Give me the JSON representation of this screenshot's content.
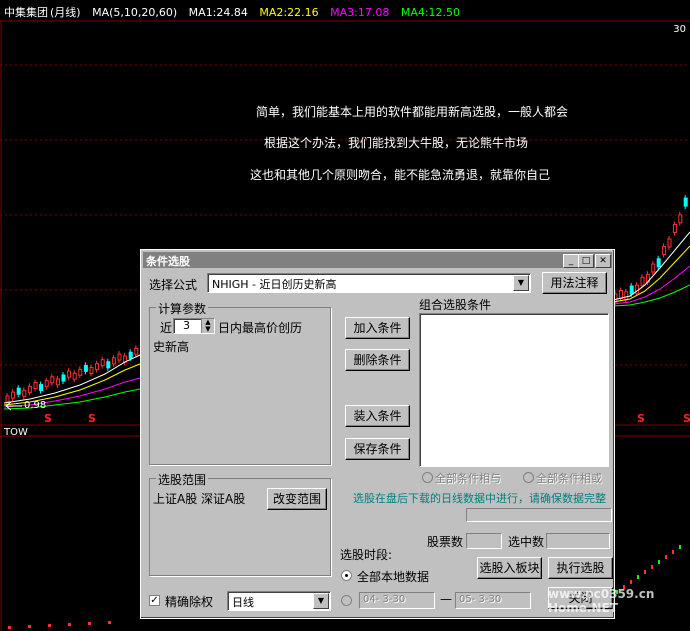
{
  "chart": {
    "stock_name": "中集集团",
    "period": "(月线)",
    "ma_params": "MA(5,10,20,60)",
    "ma1": "MA1:24.84",
    "ma2": "MA2:22.16",
    "ma3": "MA3:17.08",
    "ma4": "MA4:12.50",
    "ma_colors": {
      "ma1": "#ffffff",
      "ma2": "#ffff00",
      "ma3": "#ff00ff",
      "ma4": "#00ff00"
    },
    "indicator_label": "TOW",
    "low_price_label": "0.98",
    "right_top_value": "30",
    "signal_marker": "S",
    "messages": [
      "简单，我们能基本上用的软件都能用新高选股，一般人都会",
      "根据这个办法，我们能找到大牛股，无论熊牛市场",
      "这也和其他几个原则吻合，能不能急流勇退，就靠你自己"
    ],
    "watermark": "www.pc0359.cn Home.NET"
  },
  "dialog": {
    "title": "条件选股",
    "formula_label": "选择公式",
    "formula_value": "NHIGH    - 近日创历史新高",
    "usage_button": "用法注释",
    "calc_group": "计算参数",
    "param_prefix": "近",
    "param_value": "3",
    "param_suffix_1": "日内最高价创历",
    "param_suffix_2": "史新高",
    "combo_group": "组合选股条件",
    "add_button": "加入条件",
    "delete_button": "删除条件",
    "load_button": "装入条件",
    "save_button": "保存条件",
    "radio_and": "全部条件相与",
    "radio_or": "全部条件相或",
    "note": "选股在盘后下载的日线数据中进行，请确保数据完整",
    "range_group": "选股范围",
    "range_value": "上证A股 深证A股",
    "change_range_button": "改变范围",
    "stock_count_label": "股票数",
    "selected_label": "选中数",
    "period_label": "选股时段:",
    "all_local_label": "全部本地数据",
    "to_board_button": "选股入板块",
    "execute_button": "执行选股",
    "exact_rights_label": "精确除权",
    "cycle_value": "日线",
    "date_from": "04- 3-30",
    "date_sep": "—",
    "date_to": "05- 3-30",
    "close_button": "关闭"
  }
}
